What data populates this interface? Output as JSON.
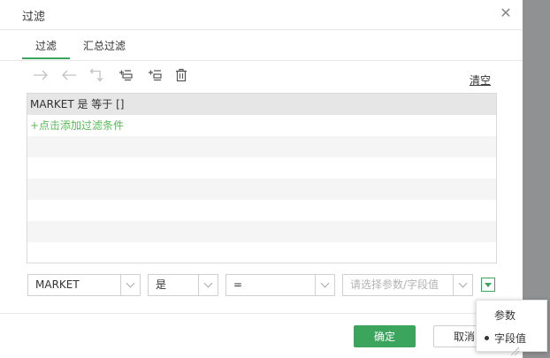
{
  "dialog": {
    "title": "过滤"
  },
  "tabs": [
    {
      "label": "过滤"
    },
    {
      "label": "汇总过滤"
    }
  ],
  "toolbar": {
    "icons": [
      "arrow-right-icon",
      "arrow-left-icon",
      "return-icon",
      "insert-condition-icon",
      "add-condition-icon",
      "delete-icon"
    ],
    "clear_label": "清空"
  },
  "filter_list": {
    "selected_condition": "MARKET 是 等于 []",
    "add_link": "+点击添加过滤条件"
  },
  "condition_editor": {
    "field": "MARKET",
    "operator_1": "是",
    "operator_2": "=",
    "value_placeholder": "请选择参数/字段值"
  },
  "value_type_menu": {
    "options": [
      "参数",
      "字段值"
    ],
    "selected": "字段值"
  },
  "footer": {
    "ok_label": "确定",
    "cancel_label": "取消"
  },
  "colors": {
    "accent": "#3ba55d",
    "link_green": "#5cb85c",
    "backdrop": "#8f9193"
  }
}
